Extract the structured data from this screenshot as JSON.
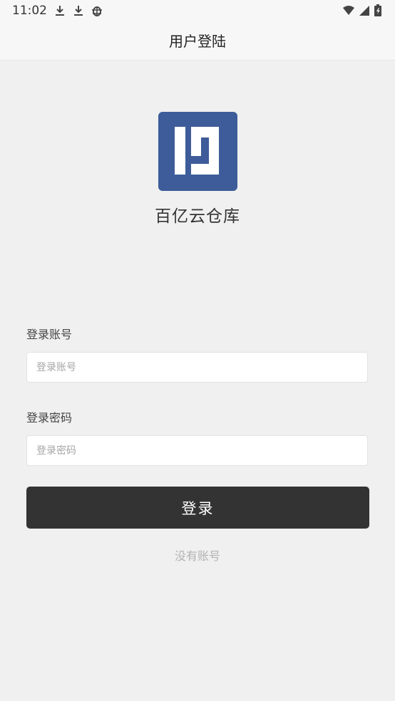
{
  "status_bar": {
    "time": "11:02",
    "left_icons": [
      "download-icon",
      "download-icon",
      "bug-icon"
    ],
    "right_icons": [
      "wifi-icon",
      "signal-icon",
      "battery-icon"
    ]
  },
  "header": {
    "title": "用户登陆"
  },
  "app": {
    "name": "百亿云仓库",
    "logo_color": "#3d5c99"
  },
  "form": {
    "account_label": "登录账号",
    "account_placeholder": "登录账号",
    "account_value": "",
    "password_label": "登录密码",
    "password_placeholder": "登录密码",
    "password_value": "",
    "submit_label": "登录",
    "signup_link": "没有账号"
  },
  "colors": {
    "background": "#f0f0f0",
    "button": "#333333",
    "logo": "#3d5c99"
  }
}
